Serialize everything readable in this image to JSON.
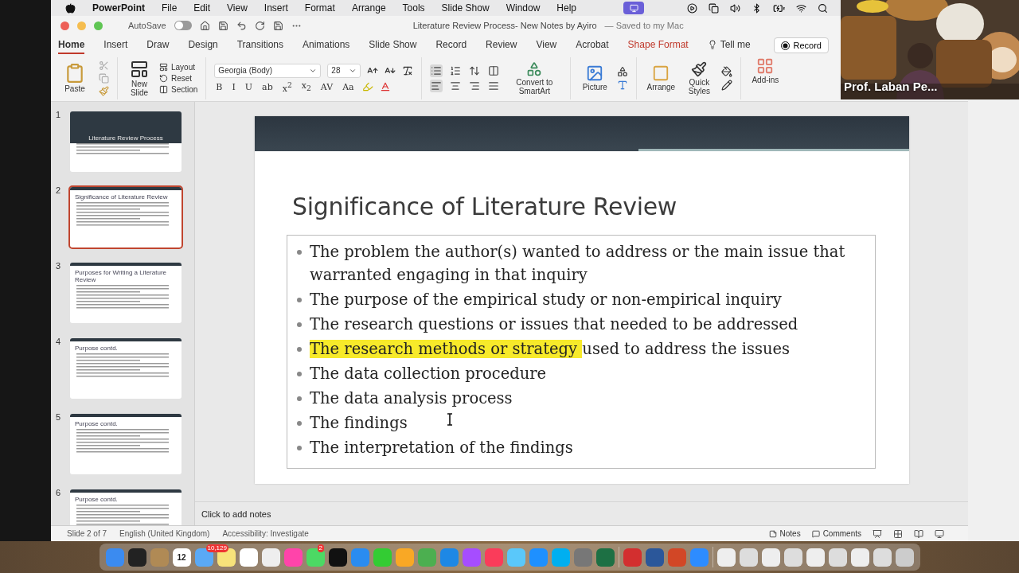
{
  "menu_bar": {
    "app": "PowerPoint",
    "items": [
      "File",
      "Edit",
      "View",
      "Insert",
      "Format",
      "Arrange",
      "Tools",
      "Slide Show",
      "Window",
      "Help"
    ]
  },
  "title_bar": {
    "autosave_label": "AutoSave",
    "autosave_on": false,
    "title": "Literature Review Process- New Notes by Ayiro",
    "saved_note": "— Saved to my Mac"
  },
  "ribbon_tabs": [
    {
      "label": "Home",
      "selected": true,
      "kind": "tab"
    },
    {
      "label": "Insert",
      "selected": false,
      "kind": "tab"
    },
    {
      "label": "Draw",
      "selected": false,
      "kind": "tab"
    },
    {
      "label": "Design",
      "selected": false,
      "kind": "tab"
    },
    {
      "label": "Transitions",
      "selected": false,
      "kind": "tab"
    },
    {
      "label": "Animations",
      "selected": false,
      "kind": "tab"
    },
    {
      "label": "Slide Show",
      "selected": false,
      "kind": "tab"
    },
    {
      "label": "Record",
      "selected": false,
      "kind": "tab"
    },
    {
      "label": "Review",
      "selected": false,
      "kind": "tab"
    },
    {
      "label": "View",
      "selected": false,
      "kind": "tab"
    },
    {
      "label": "Acrobat",
      "selected": false,
      "kind": "tab"
    },
    {
      "label": "Shape Format",
      "selected": false,
      "kind": "contextual"
    },
    {
      "label": "Tell me",
      "selected": false,
      "kind": "search"
    }
  ],
  "record_button": "Record",
  "ribbon": {
    "paste": "Paste",
    "new_slide": "New Slide",
    "slide_commands": [
      "Layout",
      "Reset",
      "Section"
    ],
    "font": "Georgia (Body)",
    "font_size": "28",
    "format_buttons": [
      "B",
      "I",
      "U",
      "ab",
      "x$^{2}$",
      "x$_{2}$",
      "AV",
      "Aa"
    ],
    "convert": "Convert to SmartArt",
    "picture": "Picture",
    "arrange": "Arrange",
    "quick_styles": "Quick Styles",
    "add_ins": "Add-ins"
  },
  "thumbnails": [
    {
      "number": "1",
      "kind": "title",
      "title": "Literature Review Process",
      "selected": false
    },
    {
      "number": "2",
      "kind": "content",
      "title": "Significance of  Literature Review",
      "selected": true
    },
    {
      "number": "3",
      "kind": "content",
      "title": "Purposes for Writing a Literature Review",
      "selected": false
    },
    {
      "number": "4",
      "kind": "content",
      "title": "Purpose contd.",
      "selected": false
    },
    {
      "number": "5",
      "kind": "content",
      "title": "Purpose contd.",
      "selected": false
    },
    {
      "number": "6",
      "kind": "content",
      "title": "Purpose contd.",
      "selected": false
    }
  ],
  "slide": {
    "title": "Significance of  Literature Review",
    "bullets": [
      {
        "segments": [
          {
            "text": "The problem the author(s) wanted to address or the main issue that warranted engaging in that inquiry",
            "highlighted": false
          }
        ]
      },
      {
        "segments": [
          {
            "text": "The purpose of the empirical study or non-empirical inquiry",
            "highlighted": false
          }
        ]
      },
      {
        "segments": [
          {
            "text": "The research questions or issues that needed to be addressed",
            "highlighted": false
          }
        ]
      },
      {
        "segments": [
          {
            "text": "The research methods or strategy",
            "highlighted": true
          },
          {
            "text": "used to address the issues",
            "highlighted": false
          }
        ]
      },
      {
        "segments": [
          {
            "text": "The data collection procedure",
            "highlighted": false
          }
        ]
      },
      {
        "segments": [
          {
            "text": "The data analysis process",
            "highlighted": false
          }
        ]
      },
      {
        "segments": [
          {
            "text": "The findings",
            "highlighted": false
          }
        ]
      },
      {
        "segments": [
          {
            "text": "The interpretation of the findings",
            "highlighted": false
          }
        ]
      }
    ]
  },
  "notes_placeholder": "Click to add notes",
  "status_bar": {
    "slide_position": "Slide 2 of 7",
    "language": "English (United Kingdom)",
    "accessibility": "Accessibility: Investigate",
    "notes": "Notes",
    "comments": "Comments"
  },
  "video": {
    "name": "Prof. Laban Pe..."
  },
  "dock": {
    "calendar_date": "12",
    "mail_badge": "10,129",
    "messages_badge": "2"
  }
}
